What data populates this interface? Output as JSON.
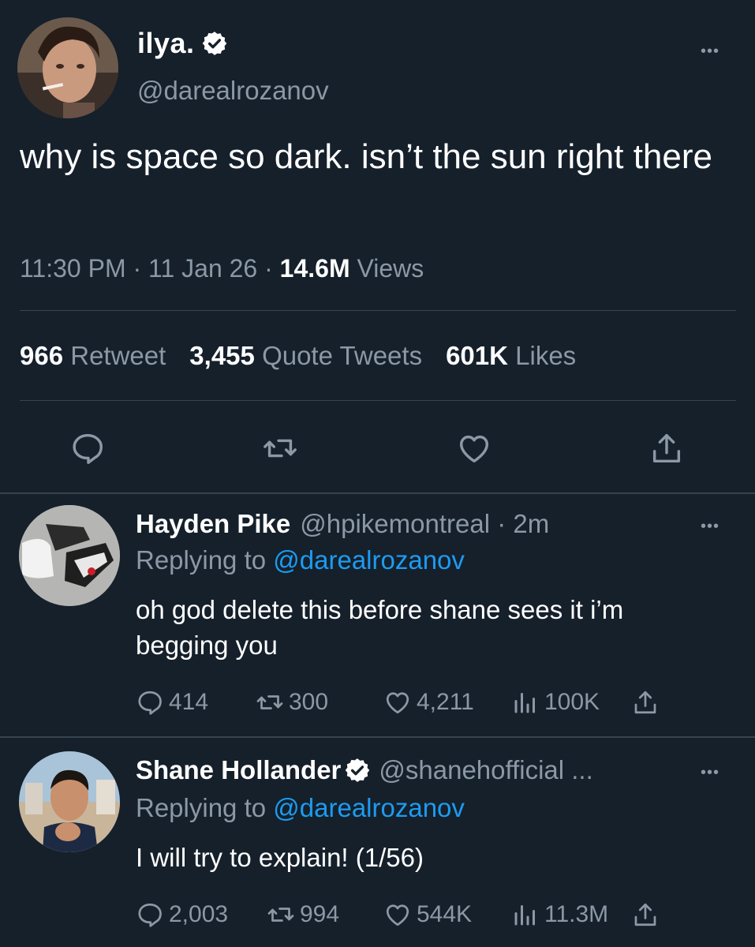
{
  "main_tweet": {
    "display_name": "ilya.",
    "handle": "@darealrozanov",
    "text": "why is space so dark. isn’t the sun right there",
    "time": "11:30 PM",
    "date": "11 Jan 26",
    "views_count": "14.6M",
    "views_label": "Views",
    "retweet_count": "966",
    "retweet_label": "Retweet",
    "quote_count": "3,455",
    "quote_label": "Quote Tweets",
    "likes_count": "601K",
    "likes_label": "Likes",
    "more": "•••"
  },
  "replies": [
    {
      "display_name": "Hayden Pike",
      "handle": "@hpikemontreal",
      "time": "2m",
      "replying_prefix": "Replying to",
      "replying_to": "@darealrozanov",
      "text": "oh god delete this before shane sees it i’m begging you",
      "reply_count": "414",
      "retweet_count": "300",
      "like_count": "4,211",
      "view_count": "100K",
      "more": "•••"
    },
    {
      "display_name": "Shane Hollander",
      "handle": "@shanehofficial ...",
      "replying_prefix": "Replying to",
      "replying_to": "@darealrozanov",
      "text": "I will try to explain! (1/56)",
      "reply_count": "2,003",
      "retweet_count": "994",
      "like_count": "544K",
      "view_count": "11.3M",
      "more": "•••"
    }
  ],
  "icons": {
    "reply": "reply-icon",
    "retweet": "retweet-icon",
    "like": "heart-icon",
    "share": "share-icon",
    "views": "views-icon",
    "verified": "verified-badge-icon"
  },
  "colors": {
    "background": "#15202b",
    "muted": "#8b98a5",
    "link": "#1d9bf0",
    "divider": "#38444d"
  }
}
